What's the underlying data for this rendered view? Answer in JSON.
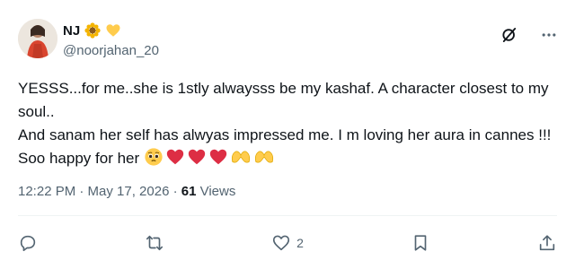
{
  "tweet": {
    "author": {
      "name": "NJ",
      "handle": "@noorjahan_20"
    },
    "badges": [
      "sunflower-icon",
      "yellow-heart-icon"
    ],
    "body": {
      "line1": "YESSS...for me..she is 1stly alwaysss be my kashaf. A character closest to my soul..",
      "line2": "And sanam her self has alwyas impressed me. I m loving her aura in cannes !!! Soo happy for her"
    },
    "emojis": [
      "pleading-face-icon",
      "red-heart-icon",
      "red-heart-icon",
      "red-heart-icon",
      "heart-hands-icon",
      "heart-hands-icon"
    ],
    "meta": {
      "timestamp": "12:22 PM · May 17, 2026 · ",
      "views_count": "61",
      "views_label": " Views"
    },
    "actions": {
      "likes": "2"
    },
    "colors": {
      "text": "#0f1419",
      "secondary": "#536471",
      "heart": "#e0245e",
      "yellow": "#ffcc4d"
    }
  }
}
